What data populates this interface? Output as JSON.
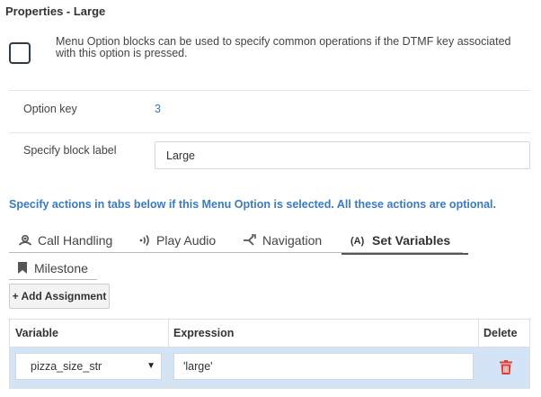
{
  "panel": {
    "title": "Properties - Large",
    "info_text": "Menu Option blocks can be used to specify common operations if the DTMF key associated with this option is pressed."
  },
  "fields": {
    "option_key_label": "Option key",
    "option_key_value": "3",
    "block_label_label": "Specify block label",
    "block_label_value": "Large"
  },
  "hint": "Specify actions in tabs below if this Menu Option is selected. All these actions are optional.",
  "tabs": [
    {
      "label": "Call Handling",
      "icon": "call-handling-icon",
      "active": false
    },
    {
      "label": "Play Audio",
      "icon": "audio-icon",
      "active": false
    },
    {
      "label": "Navigation",
      "icon": "navigation-icon",
      "active": false
    },
    {
      "label": "Set Variables",
      "icon": "variable-icon",
      "active": true
    },
    {
      "label": "Milestone",
      "icon": "bookmark-icon",
      "active": false
    }
  ],
  "add_button_label": "+ Add Assignment",
  "grid": {
    "headers": {
      "variable": "Variable",
      "expression": "Expression",
      "delete": "Delete"
    },
    "rows": [
      {
        "variable": "pizza_size_str",
        "expression": "'large'"
      }
    ]
  },
  "colors": {
    "accent": "#3a7bc0",
    "selected_row": "#d4e4f7",
    "delete": "#e0403a"
  }
}
